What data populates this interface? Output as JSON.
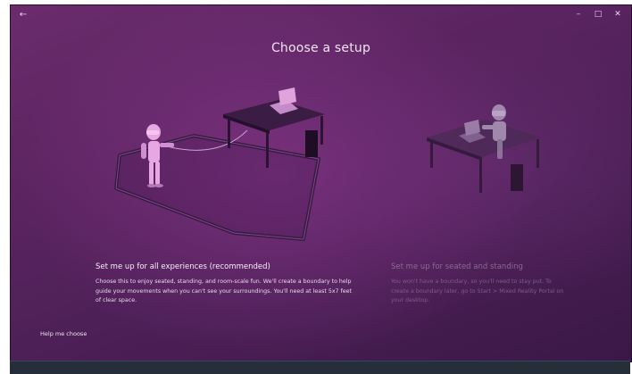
{
  "window": {
    "back_glyph": "←",
    "minimize_glyph": "–",
    "maximize_glyph": "□",
    "close_glyph": "✕"
  },
  "title": "Choose a setup",
  "options": [
    {
      "title": "Set me up for all experiences (recommended)",
      "description": "Choose this to enjoy seated, standing, and room-scale fun. We'll create a boundary to help guide your movements when you can't see your surroundings. You'll need at least 5x7 feet of clear space."
    },
    {
      "title": "Set me up for seated and standing",
      "description": "You won't have a boundary, so you'll need to stay put. To create a boundary later, go to Start > Mixed Reality Portal on your desktop."
    }
  ],
  "help_link": "Help me choose",
  "colors": {
    "background": "#5a2460",
    "accent_figure": "#e7a7e3",
    "taskbar": "#262e3a"
  },
  "icons": [
    "back-arrow-icon",
    "minimize-icon",
    "maximize-icon",
    "close-icon"
  ]
}
